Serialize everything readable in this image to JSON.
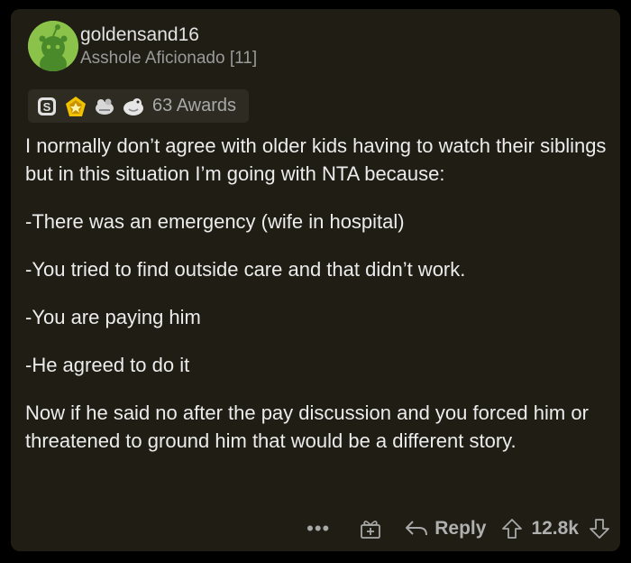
{
  "comment": {
    "username": "goldensand16",
    "flair": "Asshole Aficionado [11]",
    "awards_label": "63 Awards",
    "award_icons": [
      "silver-award-icon",
      "gold-award-icon",
      "helpful-award-icon",
      "wholesome-award-icon"
    ],
    "paragraphs": [
      "I normally don’t agree with older kids having to watch their siblings but in this situation I’m going with NTA because:",
      "-There was an emergency (wife in hospital)",
      "-You tried to find outside care and that didn’t work.",
      "-You are paying him",
      "-He agreed to do it",
      "Now if he said no after the pay discussion and you forced him or threatened to ground him that would be a different story."
    ]
  },
  "actions": {
    "more_label": "•••",
    "reply_label": "Reply",
    "score": "12.8k"
  },
  "colors": {
    "card_bg": "#1f1d14",
    "avatar_bg": "#8bc34a",
    "text": "#ececec",
    "muted": "#9a9a9a"
  }
}
